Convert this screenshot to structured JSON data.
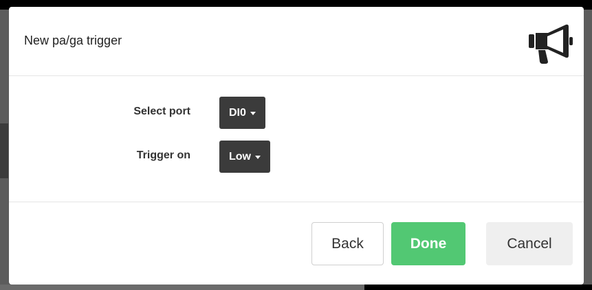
{
  "modal": {
    "title": "New pa/ga trigger",
    "header_icon": "megaphone-icon"
  },
  "form": {
    "port_label": "Select port",
    "port_value": "DI0",
    "trigger_label": "Trigger on",
    "trigger_value": "Low"
  },
  "footer": {
    "back_label": "Back",
    "done_label": "Done",
    "cancel_label": "Cancel"
  },
  "colors": {
    "dropdown_bg": "#3b3b3b",
    "done_bg": "#52c873",
    "cancel_bg": "#efefef"
  }
}
